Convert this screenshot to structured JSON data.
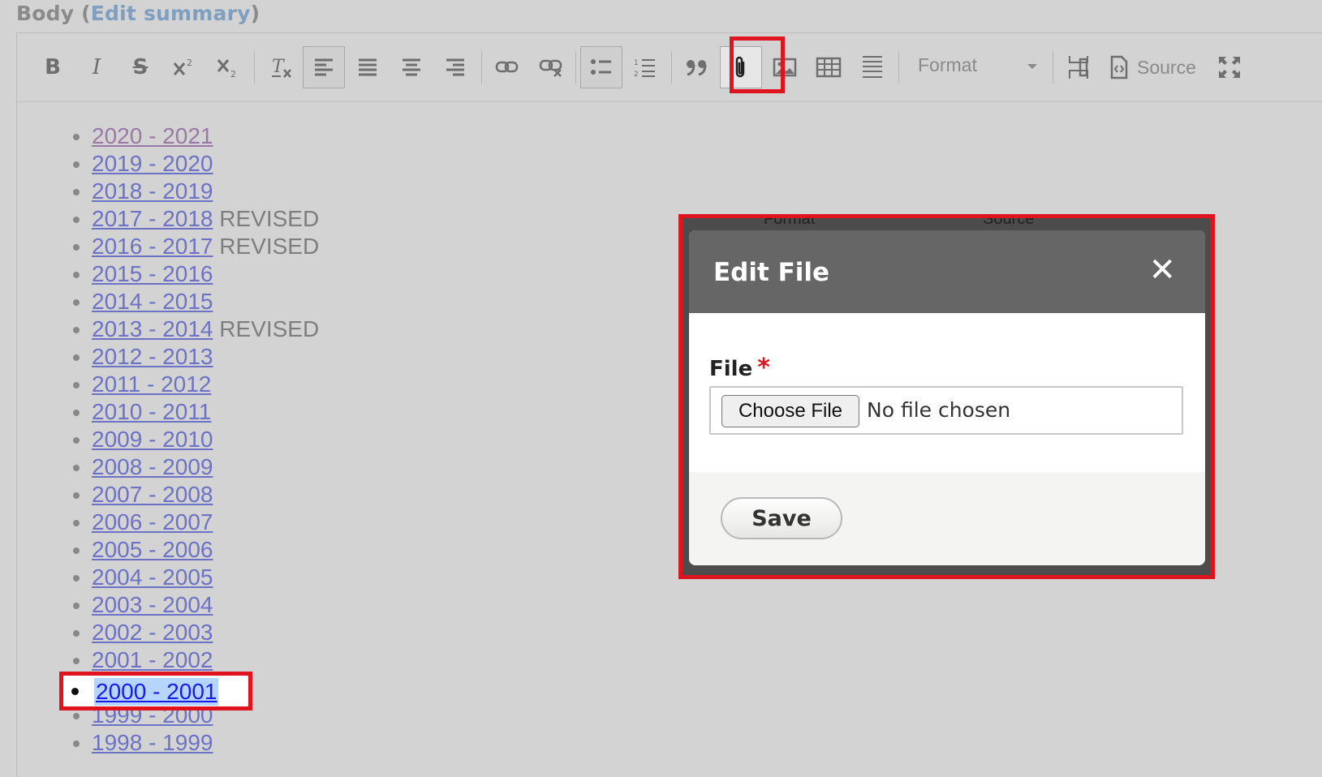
{
  "field": {
    "label": "Body",
    "open_paren": "(",
    "edit_summary": "Edit summary",
    "close_paren": ")"
  },
  "toolbar": {
    "bold": "B",
    "italic": "I",
    "strike": "S",
    "format_label": "Format",
    "source_label": "Source"
  },
  "list": [
    {
      "link": "2020 - 2021",
      "note": ""
    },
    {
      "link": "2019 - 2020",
      "note": ""
    },
    {
      "link": "2018 - 2019",
      "note": ""
    },
    {
      "link": "2017 - 2018",
      "note": " REVISED"
    },
    {
      "link": "2016 - 2017",
      "note": " REVISED"
    },
    {
      "link": "2015 - 2016",
      "note": ""
    },
    {
      "link": "2014 - 2015",
      "note": ""
    },
    {
      "link": "2013 - 2014",
      "note": " REVISED"
    },
    {
      "link": "2012 - 2013",
      "note": ""
    },
    {
      "link": "2011 - 2012",
      "note": ""
    },
    {
      "link": "2010 - 2011",
      "note": ""
    },
    {
      "link": "2009 - 2010",
      "note": ""
    },
    {
      "link": "2008 - 2009",
      "note": ""
    },
    {
      "link": "2007 - 2008",
      "note": ""
    },
    {
      "link": "2006 - 2007",
      "note": ""
    },
    {
      "link": "2005 - 2006",
      "note": ""
    },
    {
      "link": "2004 - 2005",
      "note": ""
    },
    {
      "link": "2003 - 2004",
      "note": ""
    },
    {
      "link": "2002 - 2003",
      "note": ""
    },
    {
      "link": "2001 - 2002",
      "note": ""
    },
    {
      "link": "2000 - 2001",
      "note": ""
    },
    {
      "link": "1999 - 2000",
      "note": ""
    },
    {
      "link": "1998 - 1999",
      "note": ""
    }
  ],
  "selected_item": "2000 - 2001",
  "dialog": {
    "title": "Edit File",
    "close": "✕",
    "file_label": "File",
    "required_mark": "*",
    "choose_button": "Choose File",
    "no_file": "No file chosen",
    "save_button": "Save",
    "ghost_format": "Format",
    "ghost_source": "Source"
  },
  "colors": {
    "highlight_box": "#e0141e",
    "link": "#6c72c6",
    "dialog_header": "#666666"
  }
}
